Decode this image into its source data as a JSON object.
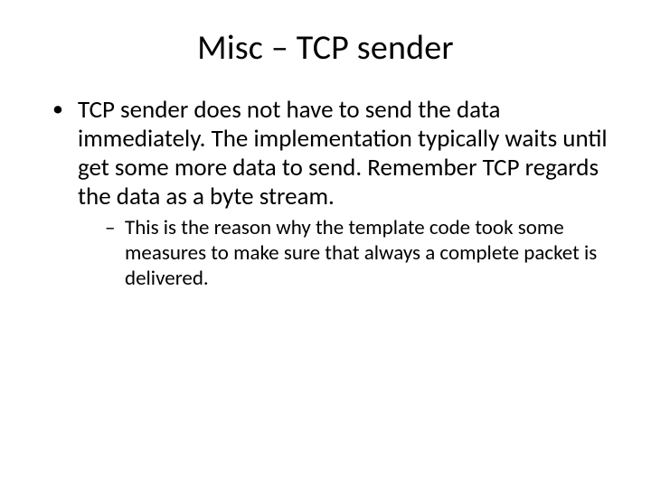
{
  "slide": {
    "title": "Misc – TCP sender",
    "bullets": [
      {
        "text": "TCP sender does not have to send the data immediately. The implementation typically waits until get some more data to send. Remember TCP regards the data as a byte stream.",
        "sub": [
          {
            "text": "This is the reason why the template code took some measures to make sure that always a complete packet is delivered."
          }
        ]
      }
    ]
  }
}
